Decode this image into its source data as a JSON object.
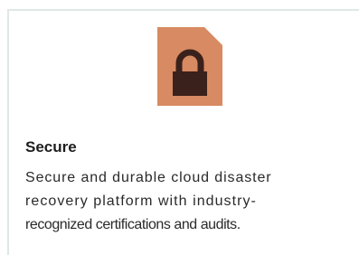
{
  "card": {
    "icon": "padlock-icon",
    "title": "Secure",
    "description_lines": [
      "Secure and durable cloud disaster",
      "recovery platform with industry-",
      "recognized certifications and audits."
    ]
  },
  "colors": {
    "icon_background": "#d88a62",
    "icon_lock": "#3b211b",
    "border": "#dfe8e5",
    "title": "#1d1d1d",
    "text": "#2a2a2a"
  }
}
